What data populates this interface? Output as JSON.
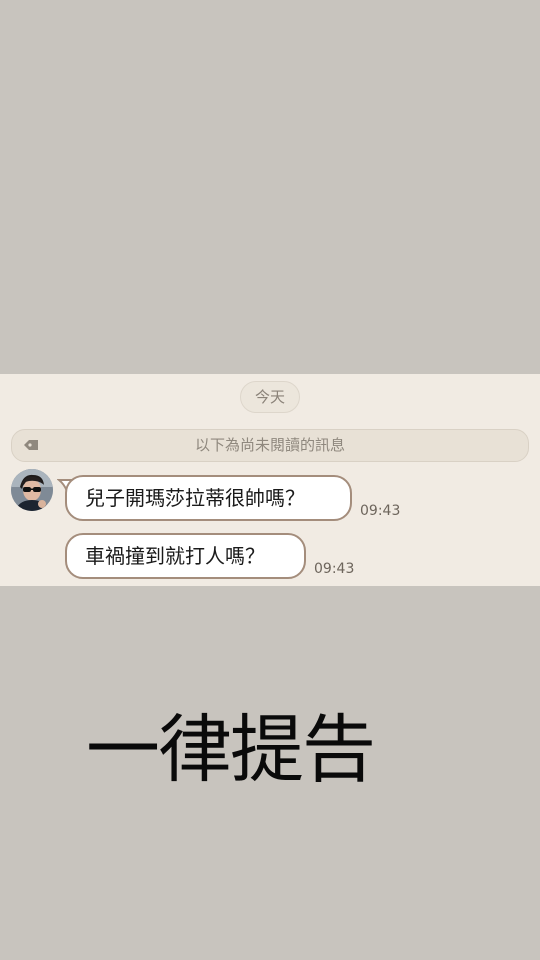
{
  "chat": {
    "date_label": "今天",
    "unread_divider_label": "以下為尚未閱讀的訊息",
    "messages": [
      {
        "text": "兒子開瑪莎拉蒂很帥嗎？",
        "time": "09:43"
      },
      {
        "text": "車禍撞到就打人嗎？",
        "time": "09:43"
      }
    ]
  },
  "caption": "一律提告",
  "colors": {
    "background": "#c8c4be",
    "chat_background": "#f1ebe3",
    "bubble_border": "#a48d7c",
    "time_text": "#6d655c"
  },
  "icons": {
    "unread_marker": "tag-icon",
    "avatar": "avatar-image"
  }
}
